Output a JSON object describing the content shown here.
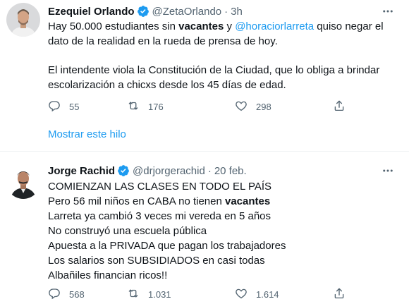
{
  "colors": {
    "accent": "#1d9bf0",
    "muted": "#536471",
    "text": "#0f1419",
    "verified": "#1d9bf0"
  },
  "tweets": [
    {
      "name": "Ezequiel Orlando",
      "handle": "@ZetaOrlando",
      "separator": "·",
      "time": "3h",
      "text": {
        "l1_a": "Hay 50.000 estudiantes sin ",
        "l1_b": "vacantes",
        "l1_c": " y ",
        "l1_mention": "@horaciorlarreta",
        "l1_d": " quiso negar el",
        "l2": "dato de la realidad en la rueda de prensa de hoy.",
        "l3": "El intendente viola la Constitución de la Ciudad, que lo obliga a brindar",
        "l4": "escolarización a chicxs desde los 45 días de edad."
      },
      "replies": "55",
      "retweets": "176",
      "likes": "298",
      "show_thread": "Mostrar este hilo",
      "icons": [
        "verified-badge-icon",
        "more-icon",
        "reply-icon",
        "retweet-icon",
        "like-icon",
        "share-icon"
      ]
    },
    {
      "name": "Jorge Rachid",
      "handle": "@drjorgerachid",
      "separator": "·",
      "time": "20 feb.",
      "text": {
        "l1": "COMIENZAN LAS CLASES EN TODO EL PAÍS",
        "l2_a": "Pero 56 mil niños en CABA no tienen ",
        "l2_b": "vacantes",
        "l3": "Larreta ya cambió 3 veces mi vereda en 5 años",
        "l4": "No construyó una escuela pública",
        "l5": "Apuesta a la PRIVADA que pagan los trabajadores",
        "l6": "Los salarios son SUBSIDIADOS en casi todas",
        "l7": "Albañiles financian ricos!!"
      },
      "replies": "568",
      "retweets": "1.031",
      "likes": "1.614",
      "icons": [
        "verified-badge-icon",
        "more-icon",
        "reply-icon",
        "retweet-icon",
        "like-icon",
        "share-icon"
      ]
    }
  ]
}
